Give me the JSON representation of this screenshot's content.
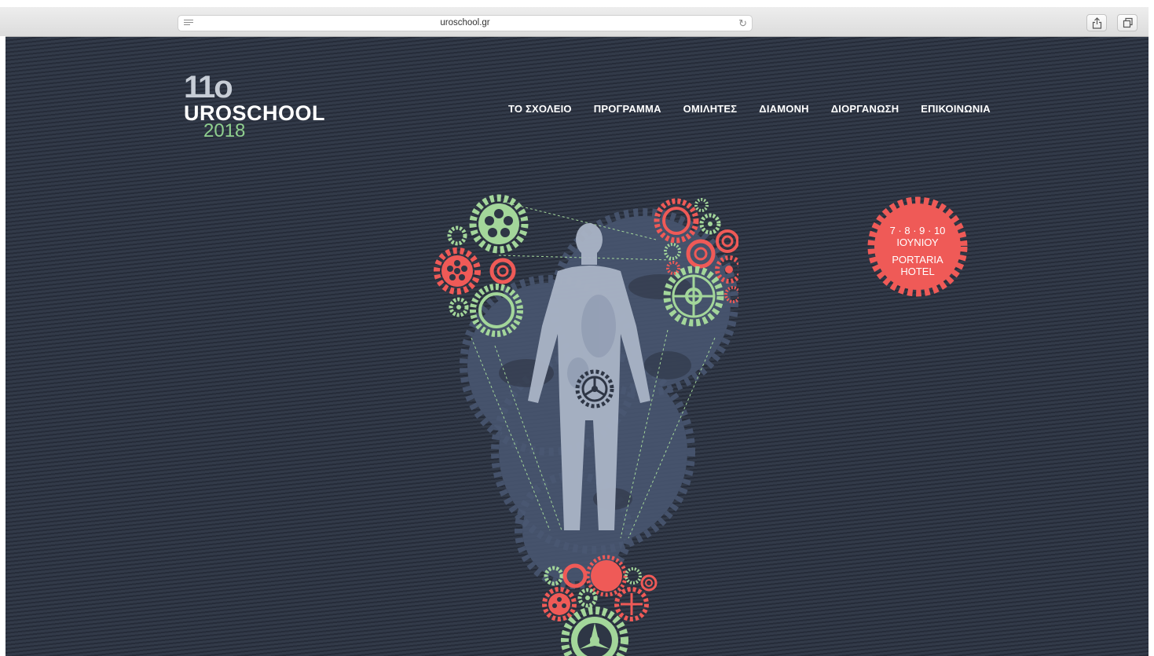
{
  "browser": {
    "url": "uroschool.gr",
    "icons": [
      "reader-icon",
      "reload-icon",
      "share-icon",
      "tabs-icon"
    ]
  },
  "logo": {
    "edition": "11o",
    "name": "UROSCHOOL",
    "year": "2018"
  },
  "nav": {
    "items": [
      "ΤΟ ΣΧΟΛΕΙΟ",
      "ΠΡΟΓΡΑΜΜΑ",
      "ΟΜΙΛΗΤΕΣ",
      "ΔΙΑΜΟΝΗ",
      "ΔΙΟΡΓΑΝΩΣΗ",
      "ΕΠΙΚΟΙΝΩΝΙΑ"
    ]
  },
  "badge": {
    "dates": "7 · 8 · 9 · 10",
    "month": "ΙΟΥΝΙΟΥ",
    "venue_line1": "PORTARIA",
    "venue_line2": "HOTEL",
    "color": "#ef5a57"
  },
  "colors": {
    "background": "#2e3645",
    "gear_green": "#a3d69a",
    "gear_red": "#ef5a57",
    "gear_slate": "#4a5873",
    "figure": "#aab4c6"
  }
}
